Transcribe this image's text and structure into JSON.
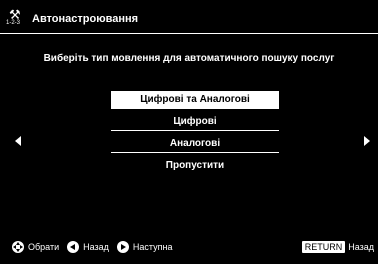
{
  "header": {
    "icon": "wrench-icon",
    "icon_caption": "1-2-3",
    "title": "Автонастроювання"
  },
  "prompt": "Виберіть тип мовлення для автоматичного пошуку послуг",
  "options": [
    {
      "label": "Цифрові та Аналогові",
      "selected": true
    },
    {
      "label": "Цифрові",
      "selected": false
    },
    {
      "label": "Аналогові",
      "selected": false
    },
    {
      "label": "Пропустити",
      "selected": false
    }
  ],
  "navigation": {
    "left_arrow": "arrow-left-icon",
    "right_arrow": "arrow-right-icon"
  },
  "footer": {
    "select_label": "Обрати",
    "back_label": "Назад",
    "next_label": "Наступна",
    "return_key": "RETURN",
    "return_label": "Назад"
  },
  "colors": {
    "background": "#000000",
    "foreground": "#ffffff",
    "selected_bg": "#ffffff",
    "selected_fg": "#000000"
  }
}
